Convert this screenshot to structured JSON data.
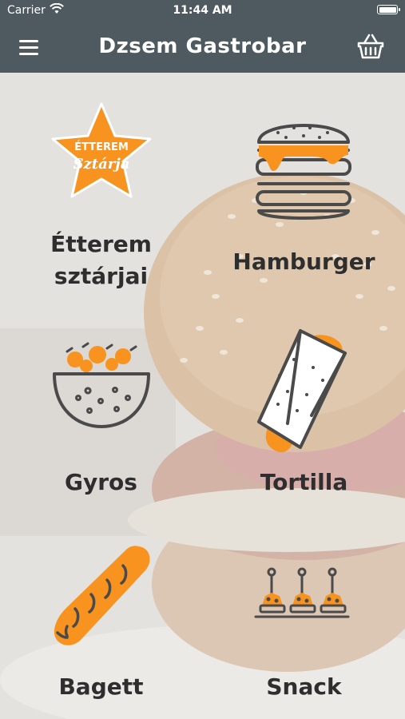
{
  "status_bar": {
    "carrier": "Carrier",
    "time": "11:44 AM"
  },
  "nav": {
    "title": "Dzsem Gastrobar"
  },
  "badge": {
    "line1": "ÉTTEREM",
    "line2": "Sztárja"
  },
  "categories": [
    {
      "label_line1": "Étterem",
      "label_line2": "sztárjai",
      "icon": "star-badge-icon"
    },
    {
      "label_line1": "Hamburger",
      "icon": "hamburger-icon"
    },
    {
      "label_line1": "Gyros",
      "icon": "gyros-bowl-icon"
    },
    {
      "label_line1": "Tortilla",
      "icon": "tortilla-wrap-icon"
    },
    {
      "label_line1": "Bagett",
      "icon": "baguette-icon"
    },
    {
      "label_line1": "Snack",
      "icon": "snack-skewers-icon"
    }
  ],
  "colors": {
    "bar": "#4f5a60",
    "accent_orange": "#f7931e",
    "icon_dark": "#4a4a4a",
    "text_dark": "#2e2e2e"
  }
}
